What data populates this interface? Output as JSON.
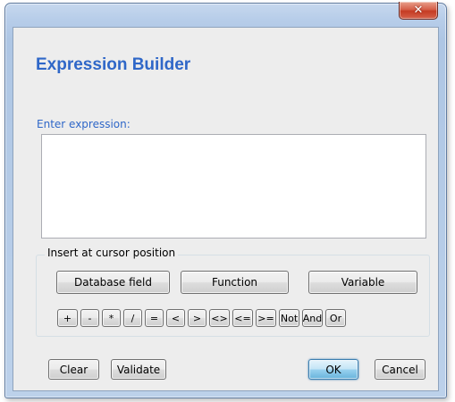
{
  "window": {
    "close_glyph": "✕"
  },
  "dialog": {
    "title": "Expression Builder",
    "expression_label": "Enter expression:",
    "expression_value": ""
  },
  "insert_group": {
    "legend": "Insert at cursor position",
    "buttons": {
      "database_field": "Database field",
      "function": "Function",
      "variable": "Variable"
    },
    "operators": [
      "+",
      "-",
      "*",
      "/",
      "=",
      "<",
      ">",
      "<>",
      "<=",
      ">=",
      "Not",
      "And",
      "Or"
    ]
  },
  "footer": {
    "clear": "Clear",
    "validate": "Validate",
    "ok": "OK",
    "cancel": "Cancel"
  }
}
